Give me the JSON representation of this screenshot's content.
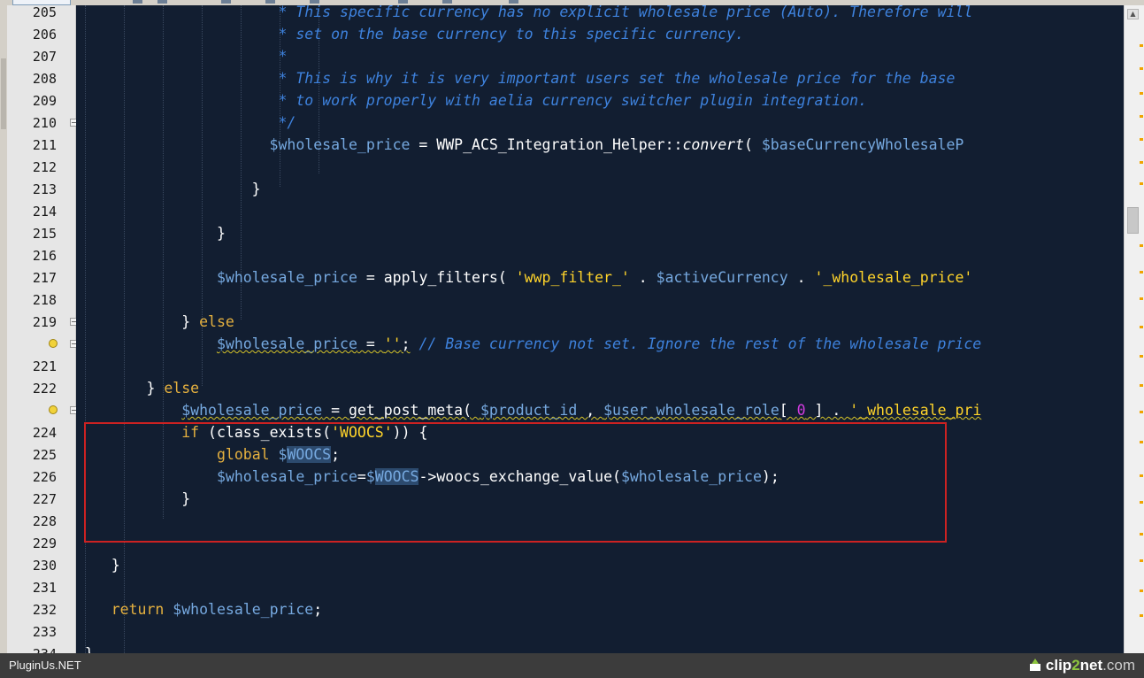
{
  "editor": {
    "lines": [
      {
        "num": "205",
        "tokens": [
          {
            "t": "                       * This specific currency has no explicit wholesale price (Auto). Therefore will",
            "c": "com"
          }
        ]
      },
      {
        "num": "206",
        "tokens": [
          {
            "t": "                       * set on the base currency to this specific currency.",
            "c": "com"
          }
        ]
      },
      {
        "num": "207",
        "tokens": [
          {
            "t": "                       *",
            "c": "com"
          }
        ]
      },
      {
        "num": "208",
        "tokens": [
          {
            "t": "                       * This is why it is very important users set the wholesale price for the base",
            "c": "com"
          }
        ]
      },
      {
        "num": "209",
        "tokens": [
          {
            "t": "                       * to work properly with aelia currency switcher plugin integration.",
            "c": "com"
          }
        ]
      },
      {
        "num": "210",
        "tokens": [
          {
            "t": "                       */",
            "c": "com"
          }
        ]
      },
      {
        "num": "211",
        "tokens": [
          {
            "t": "                      ",
            "c": "def"
          },
          {
            "t": "$wholesale_price",
            "c": "var"
          },
          {
            "t": " = WWP_ACS_Integration_Helper::",
            "c": "def"
          },
          {
            "t": "convert",
            "c": "def it"
          },
          {
            "t": "( ",
            "c": "def"
          },
          {
            "t": "$baseCurrencyWholesaleP",
            "c": "var"
          }
        ]
      },
      {
        "num": "212",
        "tokens": []
      },
      {
        "num": "213",
        "tokens": [
          {
            "t": "                    }",
            "c": "def"
          }
        ]
      },
      {
        "num": "214",
        "tokens": []
      },
      {
        "num": "215",
        "tokens": [
          {
            "t": "                }",
            "c": "def"
          }
        ]
      },
      {
        "num": "216",
        "tokens": []
      },
      {
        "num": "217",
        "tokens": [
          {
            "t": "                ",
            "c": "def"
          },
          {
            "t": "$wholesale_price",
            "c": "var"
          },
          {
            "t": " = apply_filters( ",
            "c": "def"
          },
          {
            "t": "'wwp_filter_'",
            "c": "str"
          },
          {
            "t": " . ",
            "c": "def"
          },
          {
            "t": "$activeCurrency",
            "c": "var"
          },
          {
            "t": " . ",
            "c": "def"
          },
          {
            "t": "'_wholesale_price'",
            "c": "str"
          }
        ]
      },
      {
        "num": "218",
        "tokens": []
      },
      {
        "num": "219",
        "tokens": [
          {
            "t": "            } ",
            "c": "def"
          },
          {
            "t": "else",
            "c": "kw"
          }
        ]
      },
      {
        "num": "220",
        "warn": true,
        "tokens": [
          {
            "t": "                ",
            "c": "def"
          },
          {
            "t": "$wholesale_price",
            "c": "var squig"
          },
          {
            "t": " = ",
            "c": "def squig"
          },
          {
            "t": "''",
            "c": "str squig"
          },
          {
            "t": ";",
            "c": "def squig"
          },
          {
            "t": " // Base currency not set. Ignore the rest of the wholesale price",
            "c": "com"
          }
        ]
      },
      {
        "num": "221",
        "tokens": []
      },
      {
        "num": "222",
        "tokens": [
          {
            "t": "        } ",
            "c": "def"
          },
          {
            "t": "else",
            "c": "kw"
          }
        ]
      },
      {
        "num": "223",
        "warn": true,
        "tokens": [
          {
            "t": "            ",
            "c": "def"
          },
          {
            "t": "$wholesale_price",
            "c": "var squig"
          },
          {
            "t": " = get_post_meta( ",
            "c": "def squig"
          },
          {
            "t": "$product_id",
            "c": "var squig"
          },
          {
            "t": " , ",
            "c": "def squig"
          },
          {
            "t": "$user_wholesale_role",
            "c": "var squig"
          },
          {
            "t": "[ ",
            "c": "def squig"
          },
          {
            "t": "0",
            "c": "num squig"
          },
          {
            "t": " ] . ",
            "c": "def squig"
          },
          {
            "t": "'_wholesale_pri",
            "c": "str squig"
          }
        ]
      },
      {
        "num": "224",
        "tokens": [
          {
            "t": "            ",
            "c": "def"
          },
          {
            "t": "if",
            "c": "kw"
          },
          {
            "t": " (class_exists(",
            "c": "def"
          },
          {
            "t": "'WOOCS'",
            "c": "str"
          },
          {
            "t": ")) {",
            "c": "def"
          }
        ]
      },
      {
        "num": "225",
        "tokens": [
          {
            "t": "                ",
            "c": "def"
          },
          {
            "t": "global",
            "c": "kw"
          },
          {
            "t": " ",
            "c": "def"
          },
          {
            "t": "$",
            "c": "var"
          },
          {
            "t": "WOOCS",
            "c": "var hl"
          },
          {
            "t": ";",
            "c": "def"
          }
        ]
      },
      {
        "num": "226",
        "tokens": [
          {
            "t": "                ",
            "c": "def"
          },
          {
            "t": "$wholesale_price",
            "c": "var"
          },
          {
            "t": "=",
            "c": "def"
          },
          {
            "t": "$",
            "c": "var"
          },
          {
            "t": "WOOCS",
            "c": "var hl"
          },
          {
            "t": "->woocs_exchange_value(",
            "c": "def"
          },
          {
            "t": "$wholesale_price",
            "c": "var"
          },
          {
            "t": ");",
            "c": "def"
          }
        ]
      },
      {
        "num": "227",
        "tokens": [
          {
            "t": "            }",
            "c": "def"
          }
        ]
      },
      {
        "num": "228",
        "tokens": []
      },
      {
        "num": "229",
        "tokens": []
      },
      {
        "num": "230",
        "tokens": [
          {
            "t": "    }",
            "c": "def"
          }
        ]
      },
      {
        "num": "231",
        "tokens": []
      },
      {
        "num": "232",
        "tokens": [
          {
            "t": "    ",
            "c": "def"
          },
          {
            "t": "return",
            "c": "kw"
          },
          {
            "t": " ",
            "c": "def"
          },
          {
            "t": "$wholesale_price",
            "c": "var"
          },
          {
            "t": ";",
            "c": "def"
          }
        ]
      },
      {
        "num": "233",
        "tokens": []
      },
      {
        "num": "234",
        "tokens": [
          {
            "t": " }",
            "c": "def"
          }
        ]
      }
    ]
  },
  "status_bar": {
    "left_text": "PluginUs.NET",
    "brand_a": "clip",
    "brand_b": "2",
    "brand_c": "net",
    "brand_d": ".com"
  },
  "colors": {
    "background": "#121e31",
    "comment": "#3e82dd",
    "variable": "#76a9e0",
    "string": "#ffd42a",
    "keyword": "#e6b13f",
    "number": "#d23be0",
    "annotation_box": "#cc2222"
  },
  "icons": [
    "warning-bulb-icon",
    "fold-minus-icon",
    "scroll-up-arrow-icon",
    "clip2net-logo-icon"
  ]
}
